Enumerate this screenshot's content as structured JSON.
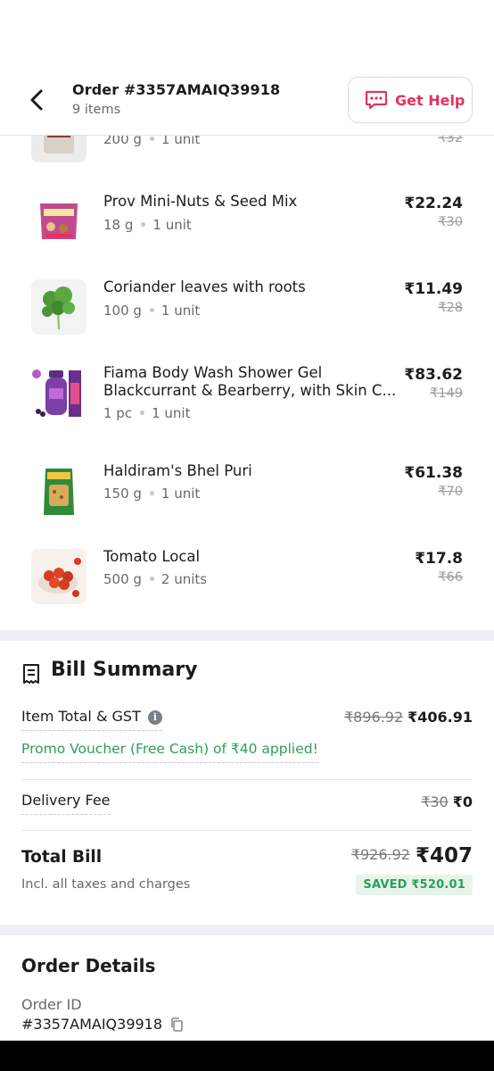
{
  "header": {
    "order_title": "Order #3357AMAIQ39918",
    "item_count": "9 items",
    "help_label": "Get Help"
  },
  "items": [
    {
      "name": "",
      "qty": "200 g",
      "units": "1 unit",
      "price": "",
      "mrp": "₹32"
    },
    {
      "name": "Prov Mini-Nuts & Seed Mix",
      "qty": "18 g",
      "units": "1 unit",
      "price": "₹22.24",
      "mrp": "₹30"
    },
    {
      "name": "Coriander leaves with roots",
      "qty": "100 g",
      "units": "1 unit",
      "price": "₹11.49",
      "mrp": "₹28"
    },
    {
      "name": "Fiama Body Wash Shower Gel Blackcurrant & Bearberry, with Skin C...",
      "qty": "1 pc",
      "units": "1 unit",
      "price": "₹83.62",
      "mrp": "₹149"
    },
    {
      "name": "Haldiram's Bhel Puri",
      "qty": "150 g",
      "units": "1 unit",
      "price": "₹61.38",
      "mrp": "₹70"
    },
    {
      "name": "Tomato Local",
      "qty": "500 g",
      "units": "2 units",
      "price": "₹17.8",
      "mrp": "₹66"
    }
  ],
  "bill": {
    "title": "Bill Summary",
    "item_total_label": "Item Total & GST",
    "item_total_mrp": "₹896.92",
    "item_total_value": "₹406.91",
    "promo_text": "Promo Voucher (Free Cash) of ₹40 applied!",
    "delivery_label": "Delivery Fee",
    "delivery_mrp": "₹30",
    "delivery_value": "₹0",
    "total_label": "Total Bill",
    "total_sub": "Incl. all taxes and charges",
    "total_mrp": "₹926.92",
    "total_value": "₹407",
    "saved": "SAVED ₹520.01"
  },
  "order_details": {
    "title": "Order Details",
    "id_label": "Order ID",
    "id_value": "#3357AMAIQ39918"
  },
  "colors": {
    "accent": "#e5315c",
    "success": "#2f9e57",
    "muted": "#696969",
    "band": "#eef0f5"
  }
}
